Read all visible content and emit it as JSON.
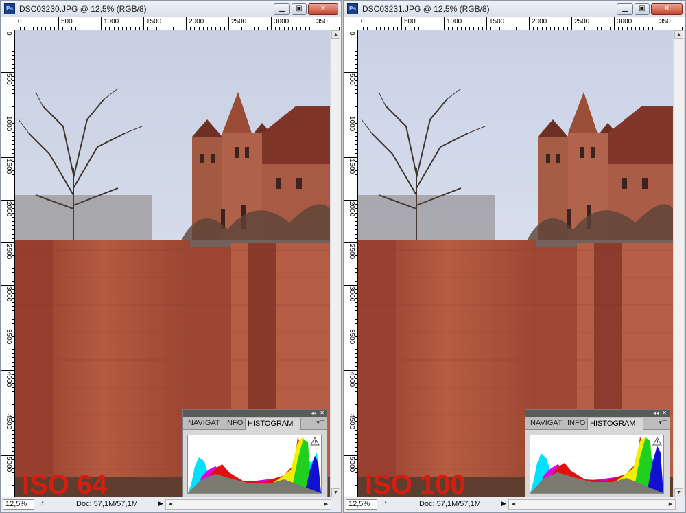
{
  "windows": [
    {
      "title": "DSC03230.JPG @ 12,5% (RGB/8)",
      "app_icon_text": "Ps",
      "zoom": "12,5%",
      "doc_info": "Doc: 57,1M/57,1M",
      "iso_label": "ISO 64",
      "ruler_h": [
        "0",
        "500",
        "1000",
        "1500",
        "2000",
        "2500",
        "3000",
        "350"
      ],
      "ruler_v": [
        "0",
        "500",
        "1000",
        "1500",
        "2000",
        "2500",
        "3000",
        "3500",
        "4000",
        "4500",
        "5000"
      ],
      "panel": {
        "tabs": [
          "NAVIGAT",
          "INFO",
          "HISTOGRAM"
        ],
        "active_tab": "HISTOGRAM"
      }
    },
    {
      "title": "DSC03231.JPG @ 12,5% (RGB/8)",
      "app_icon_text": "Ps",
      "zoom": "12,5%",
      "doc_info": "Doc: 57,1M/57,1M",
      "iso_label": "ISO 100",
      "ruler_h": [
        "0",
        "500",
        "1000",
        "1500",
        "2000",
        "2500",
        "3000",
        "350"
      ],
      "ruler_v": [
        "0",
        "500",
        "1000",
        "1500",
        "2000",
        "2500",
        "3000",
        "3500",
        "4000",
        "4500",
        "5000"
      ],
      "panel": {
        "tabs": [
          "NAVIGAT",
          "INFO",
          "HISTOGRAM"
        ],
        "active_tab": "HISTOGRAM"
      }
    }
  ],
  "icons": {
    "minimize": "minimize-icon",
    "maximize": "maximize-icon",
    "close": "close-icon",
    "warning": "warning-icon",
    "panel_menu": "panel-menu-icon"
  },
  "colors": {
    "iso_text": "#d81d10",
    "brick": "#a44a35",
    "sky": "#d9dfe9"
  }
}
